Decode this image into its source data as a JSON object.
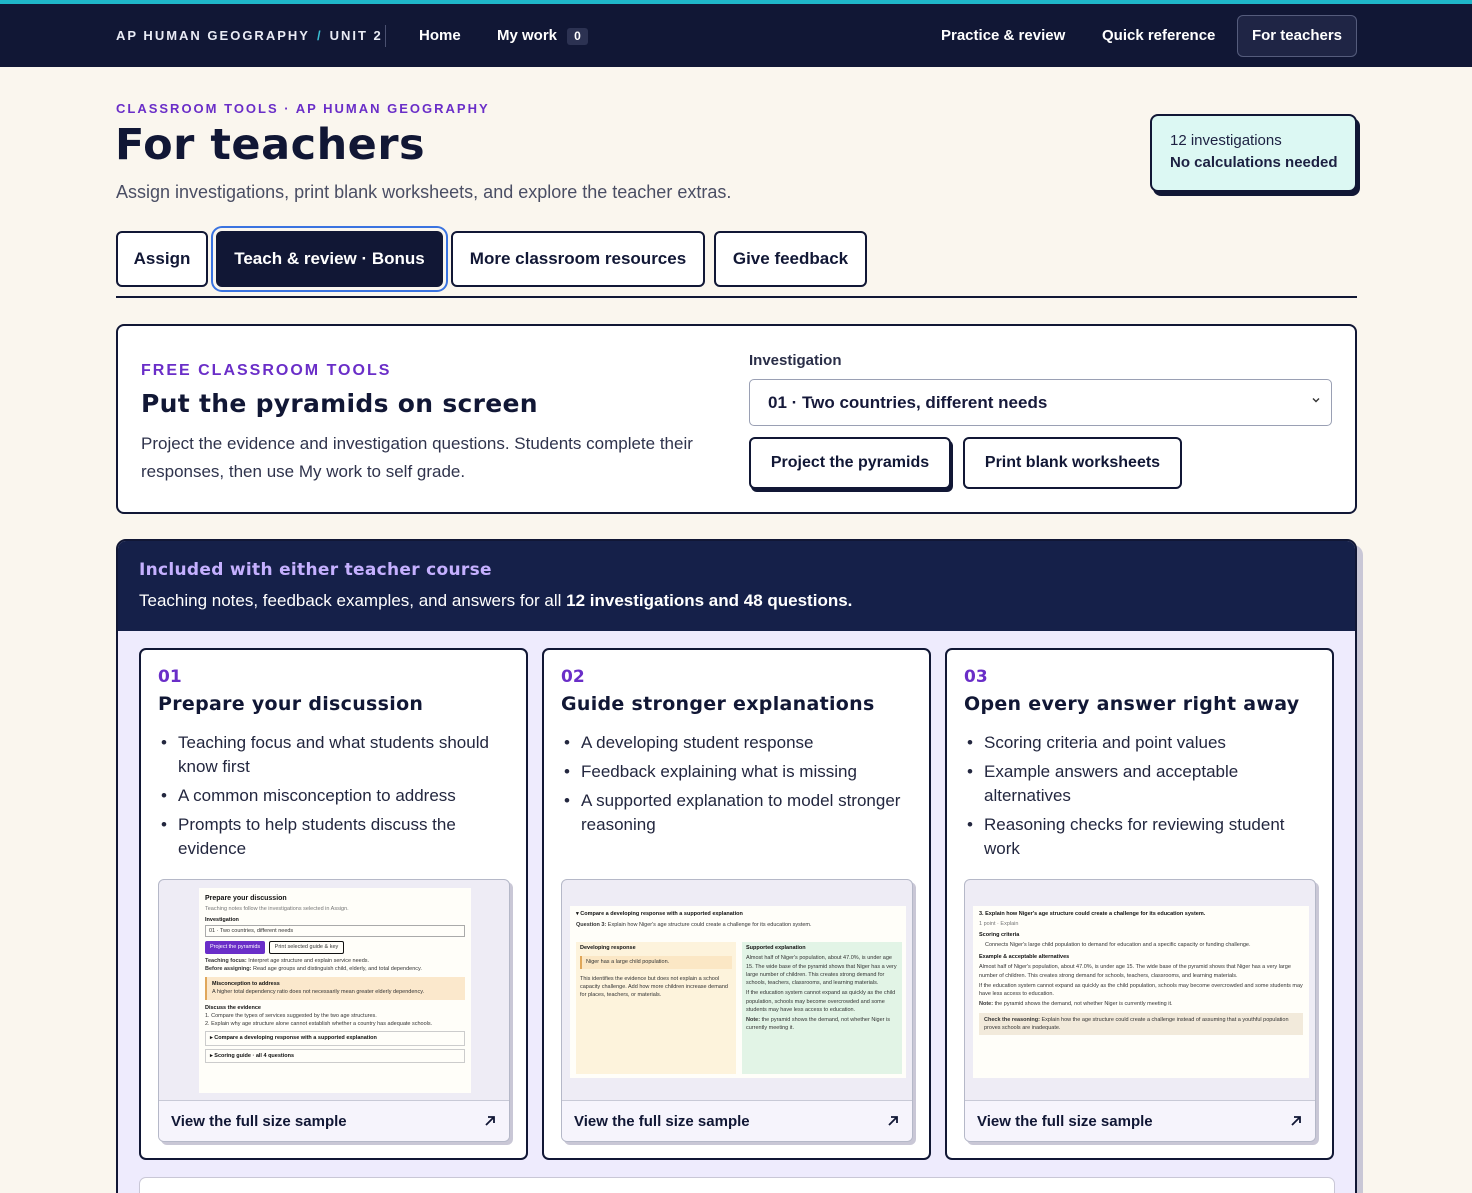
{
  "nav": {
    "brand": "AP HUMAN GEOGRAPHY",
    "separator": "/",
    "unit": "UNIT 2",
    "links": [
      "Home",
      "My work",
      "Practice & review",
      "Quick reference"
    ],
    "my_work_count": "0",
    "active_button": "For teachers",
    "accent_color": "#1fb6c9",
    "bg_color": "#111735"
  },
  "header": {
    "eyebrow": "CLASSROOM TOOLS · AP HUMAN GEOGRAPHY",
    "title": "For teachers",
    "subtitle": "Assign investigations, print blank worksheets, and explore the teacher extras.",
    "info_line1": "12 investigations",
    "info_line2": "No calculations needed"
  },
  "tabs": [
    {
      "label": "Assign",
      "active": false
    },
    {
      "label": "Teach & review · Bonus",
      "active": true
    },
    {
      "label": "More classroom resources",
      "active": false
    },
    {
      "label": "Give feedback",
      "active": false
    }
  ],
  "tools": {
    "eyebrow": "FREE CLASSROOM TOOLS",
    "title": "Put the pyramids on screen",
    "description": "Project the evidence and investigation questions. Students complete their responses, then use My work to self grade.",
    "field_label": "Investigation",
    "selected": "01 · Two countries, different needs",
    "project_button": "Project the pyramids",
    "print_button": "Print blank worksheets"
  },
  "included": {
    "title": "Included with either teacher course",
    "subtitle_prefix": "Teaching notes, feedback examples, and answers for all ",
    "subtitle_bold": "12 investigations and 48 questions.",
    "features": [
      {
        "num": "01",
        "title": "Prepare your discussion",
        "bullets": [
          "Teaching focus and what students should know first",
          "A common misconception to address",
          "Prompts to help students discuss the evidence"
        ],
        "sample_label": "View the full size sample"
      },
      {
        "num": "02",
        "title": "Guide stronger explanations",
        "bullets": [
          "A developing student response",
          "Feedback explaining what is missing",
          "A supported explanation to model stronger reasoning"
        ],
        "sample_label": "View the full size sample"
      },
      {
        "num": "03",
        "title": "Open every answer right away",
        "bullets": [
          "Scoring criteria and point values",
          "Example answers and acceptable alternatives",
          "Reasoning checks for reviewing student work"
        ],
        "sample_label": "View the full size sample"
      }
    ]
  },
  "thumb1": {
    "heading": "Prepare your discussion",
    "note": "Teaching notes follow the investigations selected in Assign.",
    "field_label": "Investigation",
    "select_value": "01 · Two countries, different needs",
    "btn1": "Project the pyramids",
    "btn2": "Print selected guide & key",
    "focus_label": "Teaching focus:",
    "focus_text": "Interpret age structure and explain service needs.",
    "before_label": "Before assigning:",
    "before_text": "Read age groups and distinguish child, elderly, and total dependency.",
    "misc_title": "Misconception to address",
    "misc_text": "A higher total dependency ratio does not necessarily mean greater elderly dependency.",
    "discuss_title": "Discuss the evidence",
    "discuss_items": [
      "1. Compare the types of services suggested by the two age structures.",
      "2. Explain why age structure alone cannot establish whether a country has adequate schools."
    ],
    "collapse1": "▸ Compare a developing response with a supported explanation",
    "collapse2": "▸ Scoring guide · all 4 questions"
  },
  "thumb2": {
    "heading": "▾ Compare a developing response with a supported explanation",
    "question_label": "Question 3:",
    "question_text": "Explain how Niger's age structure could create a challenge for its education system.",
    "dev_title": "Developing response",
    "dev_answer": "Niger has a large child population.",
    "dev_feedback": "This identifies the evidence but does not explain a school capacity challenge. Add how more children increase demand for places, teachers, or materials.",
    "sup_title": "Supported explanation",
    "sup_p1": "Almost half of Niger's population, about 47.0%, is under age 15. The wide base of the pyramid shows that Niger has a very large number of children. This creates strong demand for schools, teachers, classrooms, and learning materials.",
    "sup_p2": "If the education system cannot expand as quickly as the child population, schools may become overcrowded and some students may have less access to education.",
    "sup_note_label": "Note:",
    "sup_note": "the pyramid shows the demand, not whether Niger is currently meeting it."
  },
  "thumb3": {
    "question": "3. Explain how Niger's age structure could create a challenge for its education system.",
    "meta": "1 point · Explain",
    "criteria_title": "Scoring criteria",
    "criteria_item": "Connects Niger's large child population to demand for education and a specific capacity or funding challenge.",
    "examples_title": "Example & acceptable alternatives",
    "example_p1": "Almost half of Niger's population, about 47.0%, is under age 15. The wide base of the pyramid shows that Niger has a very large number of children. This creates strong demand for schools, teachers, classrooms, and learning materials.",
    "example_p2": "If the education system cannot expand as quickly as the child population, schools may become overcrowded and some students may have less access to education.",
    "note_label": "Note:",
    "note": "the pyramid shows the demand, not whether Niger is currently meeting it.",
    "check_label": "Check the reasoning:",
    "check_text": "Explain how the age structure could create a challenge instead of assuming that a youthful population proves schools are inadequate."
  }
}
